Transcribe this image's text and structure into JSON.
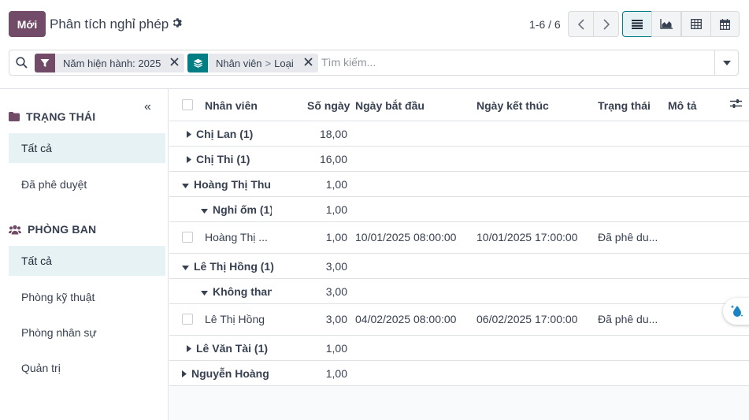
{
  "control_panel": {
    "new_button": "Mới",
    "title": "Phân tích nghỉ phép",
    "pager": "1-6 / 6"
  },
  "search": {
    "facets": [
      {
        "label": "Năm hiện hành: 2025"
      },
      {
        "label_a": "Nhân viên",
        "separator": ">",
        "label_b": "Loại"
      }
    ],
    "placeholder": "Tìm kiếm..."
  },
  "sidebar": {
    "status_heading": "TRẠNG THÁI",
    "status_items": [
      "Tất cả",
      "Đã phê duyệt"
    ],
    "department_heading": "PHÒNG BAN",
    "department_items": [
      "Tất cả",
      "Phòng kỹ thuật",
      "Phòng nhân sự",
      "Quản trị"
    ]
  },
  "table": {
    "columns": [
      "Nhân viên",
      "Số ngày",
      "Ngày bắt đầu",
      "Ngày kết thúc",
      "Trạng thái",
      "Mô tả"
    ],
    "rows": [
      {
        "name": "Chị Lan (1)",
        "days": "18,00"
      },
      {
        "name": "Chị Thi (1)",
        "days": "16,00"
      },
      {
        "name": "Hoàng Thị Thu (",
        "days": "1,00"
      },
      {
        "name": "Nghỉ ốm (1)",
        "days": "1,00"
      },
      {
        "name": "Hoàng Thị ...",
        "days": "1,00",
        "start": "10/01/2025 08:00:00",
        "end": "10/01/2025 17:00:00",
        "state": "Đã phê du..."
      },
      {
        "name": "Lê Thị Hồng (1)",
        "days": "3,00"
      },
      {
        "name": "Không thanh",
        "days": "3,00"
      },
      {
        "name": "Lê Thị Hồng",
        "days": "3,00",
        "start": "04/02/2025 08:00:00",
        "end": "06/02/2025 17:00:00",
        "state": "Đã phê du..."
      },
      {
        "name": "Lê Văn Tài (1)",
        "days": "1,00"
      },
      {
        "name": "Nguyễn Hoàng A",
        "days": "1,00"
      }
    ]
  },
  "colors": {
    "brand": "#714B67",
    "accent": "#017e84"
  }
}
